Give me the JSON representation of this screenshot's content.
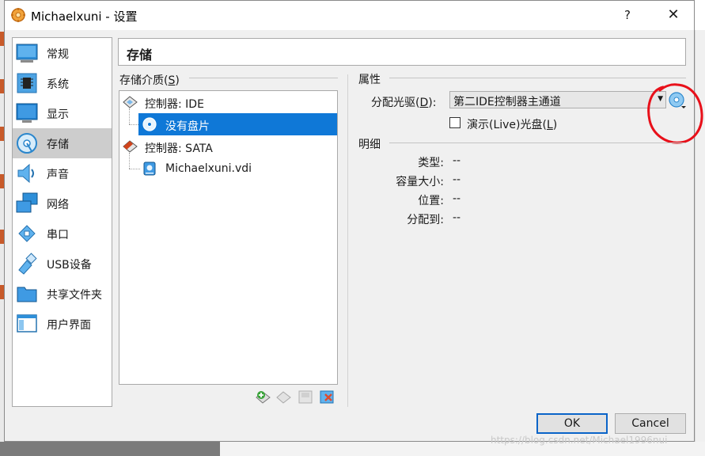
{
  "window": {
    "title": "Michaelxuni - 设置",
    "help_label": "?",
    "close_label": "✕"
  },
  "sidebar": {
    "items": [
      {
        "label": "常规",
        "icon": "general-icon"
      },
      {
        "label": "系统",
        "icon": "system-icon"
      },
      {
        "label": "显示",
        "icon": "display-icon"
      },
      {
        "label": "存储",
        "icon": "storage-icon",
        "selected": true
      },
      {
        "label": "声音",
        "icon": "audio-icon"
      },
      {
        "label": "网络",
        "icon": "network-icon"
      },
      {
        "label": "串口",
        "icon": "serial-port-icon"
      },
      {
        "label": "USB设备",
        "icon": "usb-icon"
      },
      {
        "label": "共享文件夹",
        "icon": "shared-folder-icon"
      },
      {
        "label": "用户界面",
        "icon": "user-interface-icon"
      }
    ]
  },
  "page": {
    "title": "存储"
  },
  "storage_media": {
    "label": "存储介质(",
    "label_key": "S",
    "label_end": ")",
    "tree": [
      {
        "label": "控制器: IDE",
        "icon": "ide-controller-icon",
        "level": 0
      },
      {
        "label": "没有盘片",
        "icon": "optical-disc-icon",
        "level": 1,
        "selected": true
      },
      {
        "label": "控制器: SATA",
        "icon": "sata-controller-icon",
        "level": 0
      },
      {
        "label": "Michaelxuni.vdi",
        "icon": "hard-disk-icon",
        "level": 1
      }
    ],
    "toolbar": [
      "add-controller-icon",
      "remove-controller-icon",
      "add-attachment-icon",
      "remove-attachment-icon"
    ]
  },
  "attributes": {
    "label": "属性",
    "drive_label": "分配光驱(",
    "drive_key": "D",
    "drive_end": "):",
    "drive_value": "第二IDE控制器主通道",
    "live_label": "演示(Live)光盘(",
    "live_key": "L",
    "live_end": ")",
    "live_checked": false
  },
  "details": {
    "label": "明细",
    "rows": [
      {
        "key": "类型:",
        "value": "--"
      },
      {
        "key": "容量大小:",
        "value": "--"
      },
      {
        "key": "位置:",
        "value": "--"
      },
      {
        "key": "分配到:",
        "value": "--"
      }
    ]
  },
  "buttons": {
    "ok": "OK",
    "cancel": "Cancel"
  },
  "watermark": "https://blog.csdn.net/Michael1996nui",
  "colors": {
    "selection": "#0f78d7",
    "annotation": "#e8101a"
  }
}
